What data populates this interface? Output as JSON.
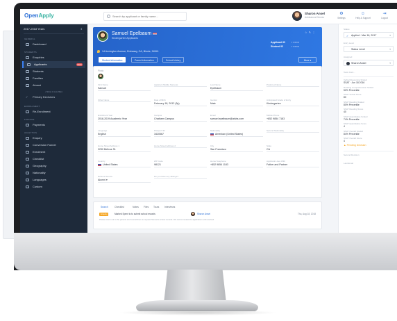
{
  "app": {
    "logo_left": "Open",
    "logo_right": "Apply",
    "search_placeholder": "Search by applicant or family name...",
    "user_name": "Sharon Ansel",
    "user_role": "Admissions Director",
    "actions": [
      {
        "glyph": "⚙",
        "label": "Settings"
      },
      {
        "glyph": "☺",
        "label": "Help & Support"
      },
      {
        "glyph": "⇥",
        "label": "Logout"
      }
    ]
  },
  "sidebar": {
    "year": "2017-2018 Years",
    "sections": {
      "general": "GENERAL",
      "students": "STUDENTS",
      "enrollment": "ENROLLMENT",
      "finance": "FINANCE",
      "analytics": "ANALYTICS"
    },
    "items": {
      "dashboard": "Dashboard",
      "enquiries": "Enquiries",
      "applicants": "Applicants",
      "applicants_badge": "NEW",
      "students": "Students",
      "families": "Families",
      "alumni": "Alumni",
      "show_more": "• Show 1 more filter •",
      "primary_decisions": "Primary Decisions",
      "re_enrollment": "Re-Enrollment",
      "payments": "Payments",
      "enquiry": "Enquiry",
      "conversion_funnel": "Conversion Funnel",
      "enrolment": "Enrolment",
      "checklist": "Checklist",
      "geography": "Geography",
      "nationality": "Nationality",
      "languages": "Languages",
      "custom": "Custom"
    }
  },
  "profile": {
    "name": "Samuel Epelbaum",
    "subtitle": "Kindergarten Applicants",
    "applicant_id_label": "Applicant ID",
    "applicant_id": "▪ ▪▪▪▪▪▪▪",
    "student_id_label": "Student ID",
    "student_id": "▪ ▪▪▪▪▪▪▪",
    "address": "14 Armington Avenue, Embassy, CA, Illinois, 94541",
    "tabs": [
      "Student information",
      "Parent information",
      "School history"
    ],
    "more": "More ▾"
  },
  "form": {
    "photo_label": "Photo",
    "fields": [
      {
        "label": "First Name",
        "value": "Samuel"
      },
      {
        "label": "Applicant Middle Name(s)",
        "value": ""
      },
      {
        "label": "Last Name",
        "value": "Epelbaum"
      },
      {
        "label": "Preferred Name",
        "value": ""
      },
      {
        "label": "Other Name",
        "value": ""
      },
      {
        "label": "Date of Birth",
        "value": "February 18, 2012 (5y)"
      },
      {
        "label": "Gender",
        "value": "Male"
      },
      {
        "label": "Anticipated Grade of Entry",
        "value": "Kindergarten"
      },
      {
        "label": "Enrollment Year",
        "value": "2018-2019 Academic Year"
      },
      {
        "label": "Campus",
        "value": "Chatham Campus"
      },
      {
        "label": "Email",
        "value": "samuel.epelbaum@aisbs.com"
      },
      {
        "label": "Mobile Phone",
        "value": "+852 9854 7183"
      },
      {
        "label": "Language",
        "value": "English"
      },
      {
        "label": "Passport ID",
        "value": "3420567"
      },
      {
        "label": "Nationality",
        "value": "American (United States)"
      },
      {
        "label": "Second Nationality",
        "value": ""
      },
      {
        "label": "Home Street Address 1",
        "value": "2230 Bellvue St."
      },
      {
        "label": "Home Street Address 2",
        "value": ""
      },
      {
        "label": "City",
        "value": "San Francisco"
      },
      {
        "label": "State",
        "value": "CA"
      },
      {
        "label": "Country",
        "value": "United States"
      },
      {
        "label": "ZIP Code",
        "value": "98121"
      },
      {
        "label": "Home Telephone",
        "value": "+852 9854 1183"
      },
      {
        "label": "Applicant Lives With",
        "value": "Father and Partner"
      },
      {
        "label": "Referral Source",
        "value": "Alumni ▾"
      },
      {
        "label": "Do you have any siblings?",
        "value": ""
      }
    ]
  },
  "activity": {
    "tabs": [
      "Search",
      "Checklist",
      "Notes",
      "Files",
      "Tours",
      "Interviews"
    ],
    "tag": "Enquiry",
    "text": "Marked Spent to to submit school records",
    "who": "Sharon Ansel",
    "date": "Thu, Aug 18, 2018",
    "note": "Please return out to the parents and remind them to request Samuel's school records. We cannot review the application until received."
  },
  "rpanel": {
    "status_label": "Status",
    "status_value": "Applied · Mar 16, 2017",
    "level_label": "Entry Level",
    "level_value": "Status Level",
    "owner_label": "Assigned",
    "owner_value": "Sharon Ansel",
    "tests_label": "Tests Cont...",
    "scores": [
      {
        "label": "Verbal Reasoning Scaled",
        "value": "SSAT · Jun 18 2016",
        "chip": "SSAT"
      },
      {
        "label": "Reading Comprehension Scaled",
        "value": "52% Percentile"
      },
      {
        "label": "SSAT Verbal Score",
        "value": "80"
      },
      {
        "label": "SSAT Reading Scaled",
        "value": "80% Percentile"
      },
      {
        "label": "SSAT Reading Score",
        "value": "40"
      },
      {
        "label": "SSAT Quantitative Scaled",
        "value": "74% Percentile"
      },
      {
        "label": "SSAT Quantitative Score",
        "value": "4"
      },
      {
        "label": "SSAT Overall Scaled",
        "value": "84% Percentile"
      },
      {
        "label": "SSAT Overall Score",
        "value": "4"
      }
    ],
    "pending": "Pending Decision",
    "caption1": "Second Decision",
    "caption2": "Last Email"
  }
}
